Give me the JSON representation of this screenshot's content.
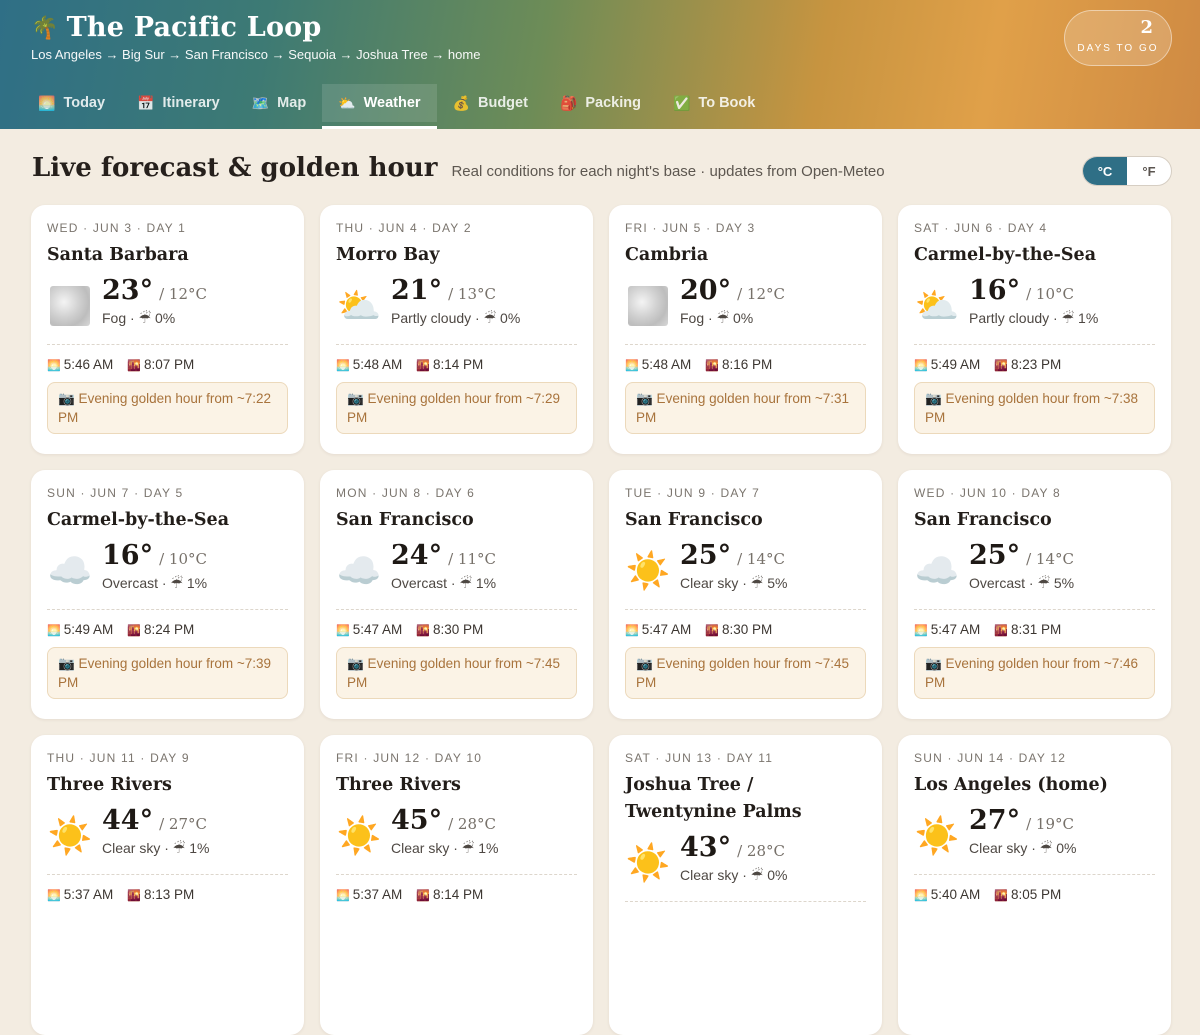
{
  "app": {
    "palm_icon": "🌴",
    "title": "The Pacific Loop",
    "route": "Los Angeles → Big Sur → San Francisco → Sequoia → Joshua Tree → home",
    "countdown_num": "2",
    "countdown_label": "DAYS TO GO"
  },
  "tabs": [
    {
      "icon": "🌅",
      "label": "Today"
    },
    {
      "icon": "📅",
      "label": "Itinerary"
    },
    {
      "icon": "🗺️",
      "label": "Map"
    },
    {
      "icon": "⛅",
      "label": "Weather"
    },
    {
      "icon": "💰",
      "label": "Budget"
    },
    {
      "icon": "🎒",
      "label": "Packing"
    },
    {
      "icon": "✅",
      "label": "To Book"
    }
  ],
  "section": {
    "title": "Live forecast & golden hour",
    "subtitle": "Real conditions for each night's base · updates from Open-Meteo"
  },
  "units": {
    "celsius": "°C",
    "fahrenheit": "°F",
    "active": "celsius"
  },
  "icons": {
    "sunrise": "🌅",
    "sunset": "🌇",
    "camera": "📷",
    "umbrella": "☔"
  },
  "cards": [
    {
      "meta": "WED · JUN 3 · DAY 1",
      "place": "Santa Barbara",
      "icon": "fog",
      "hi": "23°",
      "lo": "/ 12°C",
      "cond": "Fog · ☔ 0%",
      "sunrise": "5:46 AM",
      "sunset": "8:07 PM",
      "golden": "📷 Evening golden hour from ~7:22 PM"
    },
    {
      "meta": "THU · JUN 4 · DAY 2",
      "place": "Morro Bay",
      "icon": "⛅",
      "hi": "21°",
      "lo": "/ 13°C",
      "cond": "Partly cloudy · ☔ 0%",
      "sunrise": "5:48 AM",
      "sunset": "8:14 PM",
      "golden": "📷 Evening golden hour from ~7:29 PM"
    },
    {
      "meta": "FRI · JUN 5 · DAY 3",
      "place": "Cambria",
      "icon": "fog",
      "hi": "20°",
      "lo": "/ 12°C",
      "cond": "Fog · ☔ 0%",
      "sunrise": "5:48 AM",
      "sunset": "8:16 PM",
      "golden": "📷 Evening golden hour from ~7:31 PM"
    },
    {
      "meta": "SAT · JUN 6 · DAY 4",
      "place": "Carmel-by-the-Sea",
      "icon": "⛅",
      "hi": "16°",
      "lo": "/ 10°C",
      "cond": "Partly cloudy · ☔ 1%",
      "sunrise": "5:49 AM",
      "sunset": "8:23 PM",
      "golden": "📷 Evening golden hour from ~7:38 PM"
    },
    {
      "meta": "SUN · JUN 7 · DAY 5",
      "place": "Carmel-by-the-Sea",
      "icon": "☁️",
      "hi": "16°",
      "lo": "/ 10°C",
      "cond": "Overcast · ☔ 1%",
      "sunrise": "5:49 AM",
      "sunset": "8:24 PM",
      "golden": "📷 Evening golden hour from ~7:39 PM"
    },
    {
      "meta": "MON · JUN 8 · DAY 6",
      "place": "San Francisco",
      "icon": "☁️",
      "hi": "24°",
      "lo": "/ 11°C",
      "cond": "Overcast · ☔ 1%",
      "sunrise": "5:47 AM",
      "sunset": "8:30 PM",
      "golden": "📷 Evening golden hour from ~7:45 PM"
    },
    {
      "meta": "TUE · JUN 9 · DAY 7",
      "place": "San Francisco",
      "icon": "☀️",
      "hi": "25°",
      "lo": "/ 14°C",
      "cond": "Clear sky · ☔ 5%",
      "sunrise": "5:47 AM",
      "sunset": "8:30 PM",
      "golden": "📷 Evening golden hour from ~7:45 PM"
    },
    {
      "meta": "WED · JUN 10 · DAY 8",
      "place": "San Francisco",
      "icon": "☁️",
      "hi": "25°",
      "lo": "/ 14°C",
      "cond": "Overcast · ☔ 5%",
      "sunrise": "5:47 AM",
      "sunset": "8:31 PM",
      "golden": "📷 Evening golden hour from ~7:46 PM"
    },
    {
      "meta": "THU · JUN 11 · DAY 9",
      "place": "Three Rivers",
      "icon": "☀️",
      "hi": "44°",
      "lo": "/ 27°C",
      "cond": "Clear sky · ☔ 1%",
      "sunrise": "5:37 AM",
      "sunset": "8:13 PM",
      "golden": ""
    },
    {
      "meta": "FRI · JUN 12 · DAY 10",
      "place": "Three Rivers",
      "icon": "☀️",
      "hi": "45°",
      "lo": "/ 28°C",
      "cond": "Clear sky · ☔ 1%",
      "sunrise": "5:37 AM",
      "sunset": "8:14 PM",
      "golden": ""
    },
    {
      "meta": "SAT · JUN 13 · DAY 11",
      "place": "Joshua Tree / Twentynine Palms",
      "icon": "☀️",
      "hi": "43°",
      "lo": "/ 28°C",
      "cond": "Clear sky · ☔ 0%",
      "sunrise": "",
      "sunset": "",
      "golden": ""
    },
    {
      "meta": "SUN · JUN 14 · DAY 12",
      "place": "Los Angeles (home)",
      "icon": "☀️",
      "hi": "27°",
      "lo": "/ 19°C",
      "cond": "Clear sky · ☔ 0%",
      "sunrise": "5:40 AM",
      "sunset": "8:05 PM",
      "golden": ""
    }
  ],
  "colors": {
    "accent": "#2f6f86",
    "golden_text": "#a8733c",
    "background": "#f3ece1"
  }
}
